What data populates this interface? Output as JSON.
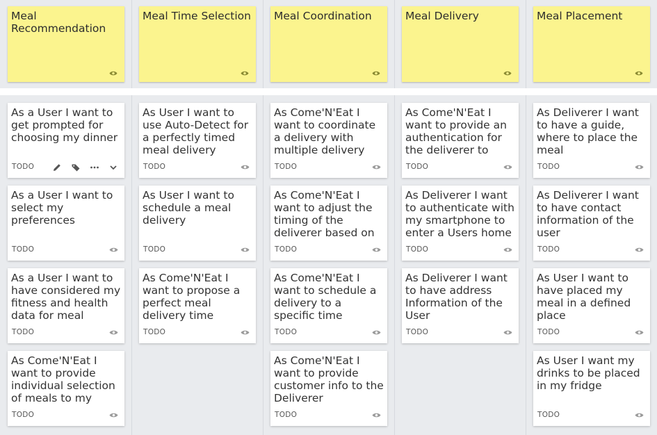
{
  "colors": {
    "epic": "#fbf48e",
    "card": "#ffffff",
    "board": "#e9ebee",
    "icon_epic": "#8a8a32",
    "icon_card": "#9a9a9a"
  },
  "columns": [
    {
      "epic": {
        "title": "Meal Recommendation",
        "icon": "eye-icon"
      },
      "cards": [
        {
          "text": "As a User I want to get prompted for choosing my dinner",
          "status": "TODO"
        },
        {
          "text": "As a User I want to select my preferences",
          "status": "TODO"
        },
        {
          "text": "As a User I want to have considered my fitness and health data for meal",
          "status": "TODO"
        },
        {
          "text": "As Come'N'Eat I want to provide individual selection of meals to my customer",
          "status": "TODO"
        }
      ]
    },
    {
      "epic": {
        "title": "Meal Time Selection",
        "icon": "eye-icon"
      },
      "cards": [
        {
          "text": "As User I want to use Auto-Detect for a perfectly timed meal delivery",
          "status": "TODO"
        },
        {
          "text": "As User I want to schedule a meal delivery",
          "status": "TODO"
        },
        {
          "text": "As Come'N'Eat I want to propose a perfect meal delivery time through calendars",
          "status": "TODO"
        }
      ]
    },
    {
      "epic": {
        "title": "Meal Coordination",
        "icon": "eye-icon"
      },
      "cards": [
        {
          "text": "As Come'N'Eat I want to coordinate a delivery with multiple delivery services",
          "status": "TODO"
        },
        {
          "text": "As Come'N'Eat I want to adjust the timing of the deliverer based on User Behavior",
          "status": "TODO"
        },
        {
          "text": "As Come'N'Eat I want to schedule a delivery to a specific time",
          "status": "TODO"
        },
        {
          "text": "As Come'N'Eat I want to provide customer info to the Deliverer",
          "status": "TODO"
        }
      ]
    },
    {
      "epic": {
        "title": "Meal Delivery",
        "icon": "eye-icon"
      },
      "cards": [
        {
          "text": "As Come'N'Eat I want to provide an authentication for the deliverer to enter a",
          "status": "TODO"
        },
        {
          "text": "As Deliverer I want to authenticate with my smartphone to enter a Users home",
          "status": "TODO"
        },
        {
          "text": "As Deliverer I want to have address Information of the User",
          "status": "TODO"
        }
      ]
    },
    {
      "epic": {
        "title": "Meal Placement",
        "icon": "eye-icon"
      },
      "cards": [
        {
          "text": "As Deliverer I want to have a guide, where to place the meal",
          "status": "TODO"
        },
        {
          "text": "As Deliverer I want to have contact information of the user",
          "status": "TODO"
        },
        {
          "text": "As User I want to have placed my meal in a defined place",
          "status": "TODO"
        },
        {
          "text": "As User I want my drinks to be placed in my fridge",
          "status": "TODO"
        }
      ]
    }
  ],
  "hover_actions": [
    "pencil-icon",
    "tag-icon",
    "more-icon",
    "chevron-down-icon"
  ]
}
